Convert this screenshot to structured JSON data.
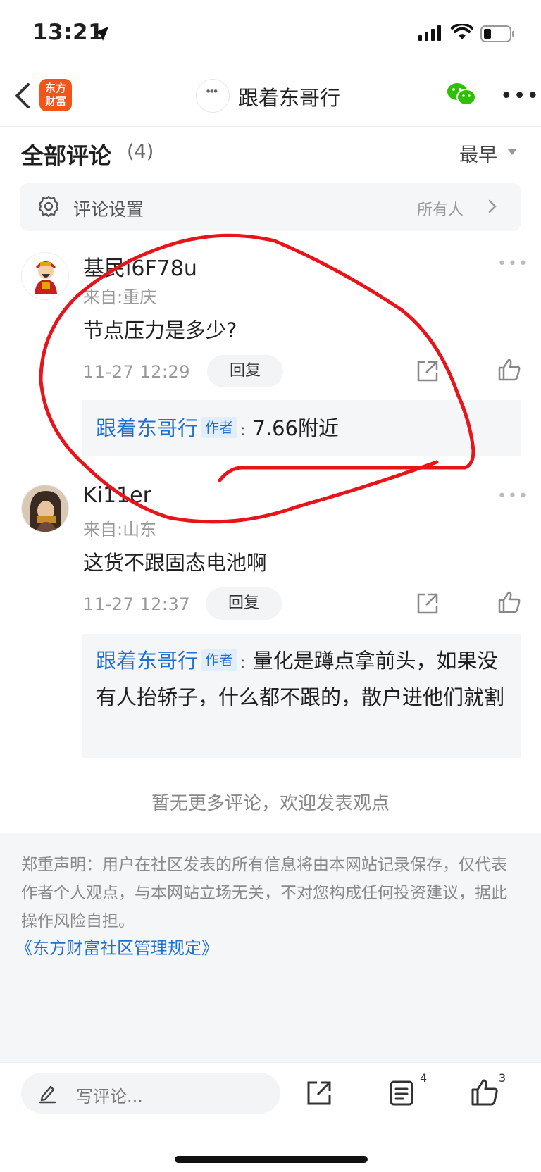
{
  "status_bar": {
    "time": "13:21"
  },
  "nav": {
    "logo_text_line1": "东方",
    "logo_text_line2": "财富",
    "title": "跟着东哥行"
  },
  "comments_header": {
    "title": "全部评论",
    "count": "(4)",
    "sort": "最早"
  },
  "settings": {
    "label": "评论设置",
    "value": "所有人"
  },
  "comments": [
    {
      "user": "基民i6F78u",
      "from": "来自:重庆",
      "text": "节点压力是多少?",
      "time": "11-27 12:29",
      "reply_label": "回复",
      "author_reply": {
        "author": "跟着东哥行",
        "badge": "作者",
        "colon": ":",
        "text": "7.66附近"
      }
    },
    {
      "user": "Ki11er",
      "from": "来自:山东",
      "text": "这货不跟固态电池啊",
      "time": "11-27 12:37",
      "reply_label": "回复",
      "author_reply": {
        "author": "跟着东哥行",
        "badge": "作者",
        "colon": ":",
        "text": "量化是蹲点拿前头，如果没有人抬轿子，什么都不跟的，散户进他们就割"
      }
    }
  ],
  "footer": {
    "no_more": "暂无更多评论，欢迎发表观点",
    "disclaimer": "郑重声明：用户在社区发表的所有信息将由本网站记录保存，仅代表作者个人观点，与本网站立场无关，不对您构成任何投资建议，据此操作风险自担。",
    "rules_link": "《东方财富社区管理规定》"
  },
  "bottom_bar": {
    "input_placeholder": "写评论...",
    "comment_count": "4",
    "like_count": "3"
  },
  "colors": {
    "link_blue": "#1f6fd1",
    "logo_orange": "#f2541a",
    "annotation_red": "#e8141a",
    "wechat_green": "#2dc100"
  }
}
